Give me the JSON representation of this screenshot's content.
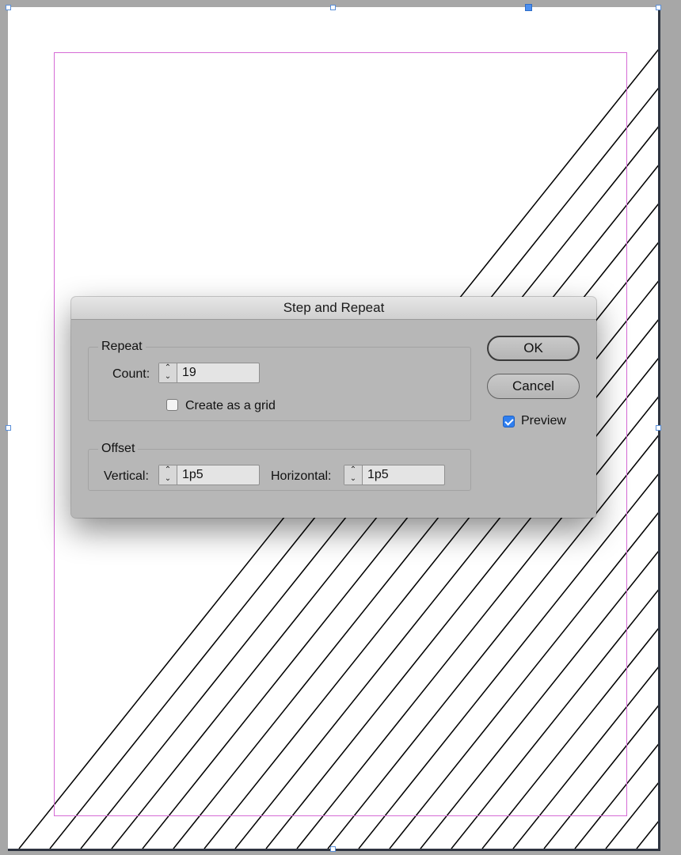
{
  "document": {
    "page_color": "#ffffff",
    "pasteboard_color": "#a7a7a7",
    "margin_guide_color": "#d66bd6",
    "line_color": "#000000"
  },
  "dialog": {
    "title": "Step and Repeat",
    "repeat": {
      "group_label": "Repeat",
      "count_label": "Count:",
      "count_value": "19",
      "create_grid_label": "Create as a grid",
      "create_grid_checked": false
    },
    "offset": {
      "group_label": "Offset",
      "vertical_label": "Vertical:",
      "vertical_value": "1p5",
      "horizontal_label": "Horizontal:",
      "horizontal_value": "1p5"
    },
    "ok_label": "OK",
    "cancel_label": "Cancel",
    "preview_label": "Preview",
    "preview_checked": true,
    "accent_color": "#2f7ff0"
  }
}
